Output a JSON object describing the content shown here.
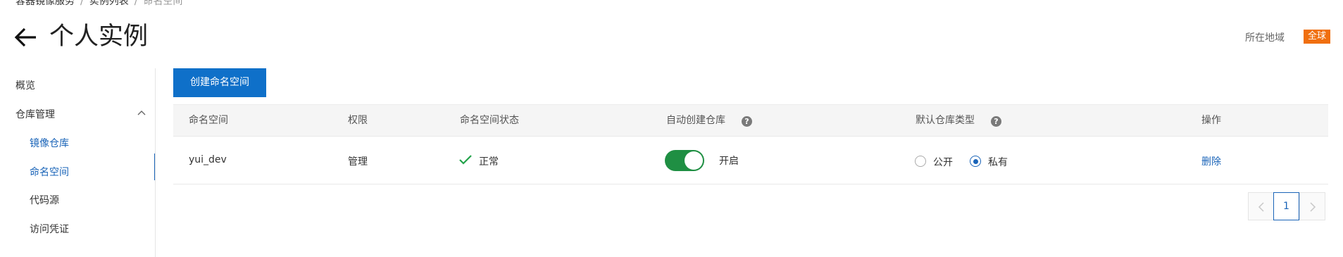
{
  "breadcrumb": {
    "items": [
      "容器镜像服务",
      "实例列表"
    ],
    "current": "命名空间",
    "separator": "/"
  },
  "header": {
    "title": "个人实例",
    "region_label": "所在地域",
    "region_value": "全球"
  },
  "sidebar": {
    "overview": "概览",
    "repo_management": "仓库管理",
    "items": [
      "镜像仓库",
      "命名空间",
      "代码源",
      "访问凭证"
    ],
    "active_index": 1
  },
  "toolbar": {
    "create_label": "创建命名空间"
  },
  "table": {
    "columns": [
      "命名空间",
      "权限",
      "命名空间状态",
      "自动创建仓库",
      "默认仓库类型",
      "操作"
    ],
    "rows": [
      {
        "namespace": "yui_dev",
        "permission": "管理",
        "status": "正常",
        "auto_create": "开启",
        "auto_create_on": true,
        "repo_type_public": "公开",
        "repo_type_private": "私有",
        "repo_type_selected": "私有",
        "action": "删除"
      }
    ]
  },
  "pagination": {
    "current_page": "1"
  },
  "colors": {
    "primary": "#0f70c9",
    "link": "#1a64b8",
    "region_badge": "#f06f0f",
    "toggle_on": "#1f8f43",
    "status_ok": "#22a34a"
  },
  "icons": {
    "back": "arrow-left-icon",
    "collapse": "chevron-up-icon",
    "help": "question-circle-icon",
    "status": "check-icon",
    "prev": "chevron-left-icon",
    "next": "chevron-right-icon"
  }
}
